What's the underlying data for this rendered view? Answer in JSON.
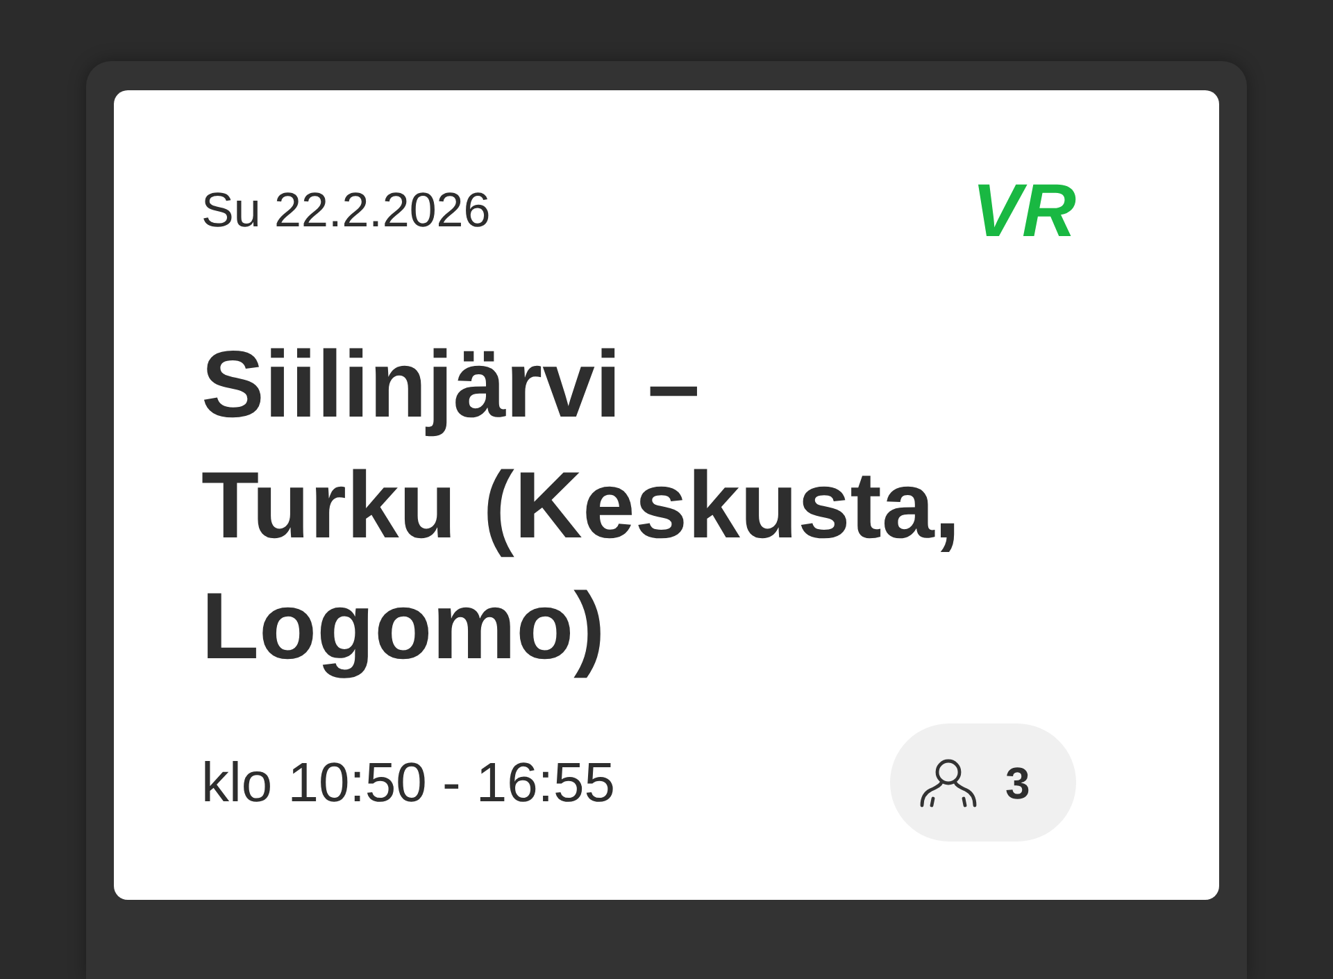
{
  "ticket": {
    "date": "Su 22.2.2026",
    "logo": "VR",
    "title": {
      "origin": "Siilinjärvi",
      "separator": "–",
      "destination": "Turku (Keskusta, Logomo)"
    },
    "time": "klo 10:50 - 16:55",
    "passengers": {
      "count": "3"
    }
  }
}
